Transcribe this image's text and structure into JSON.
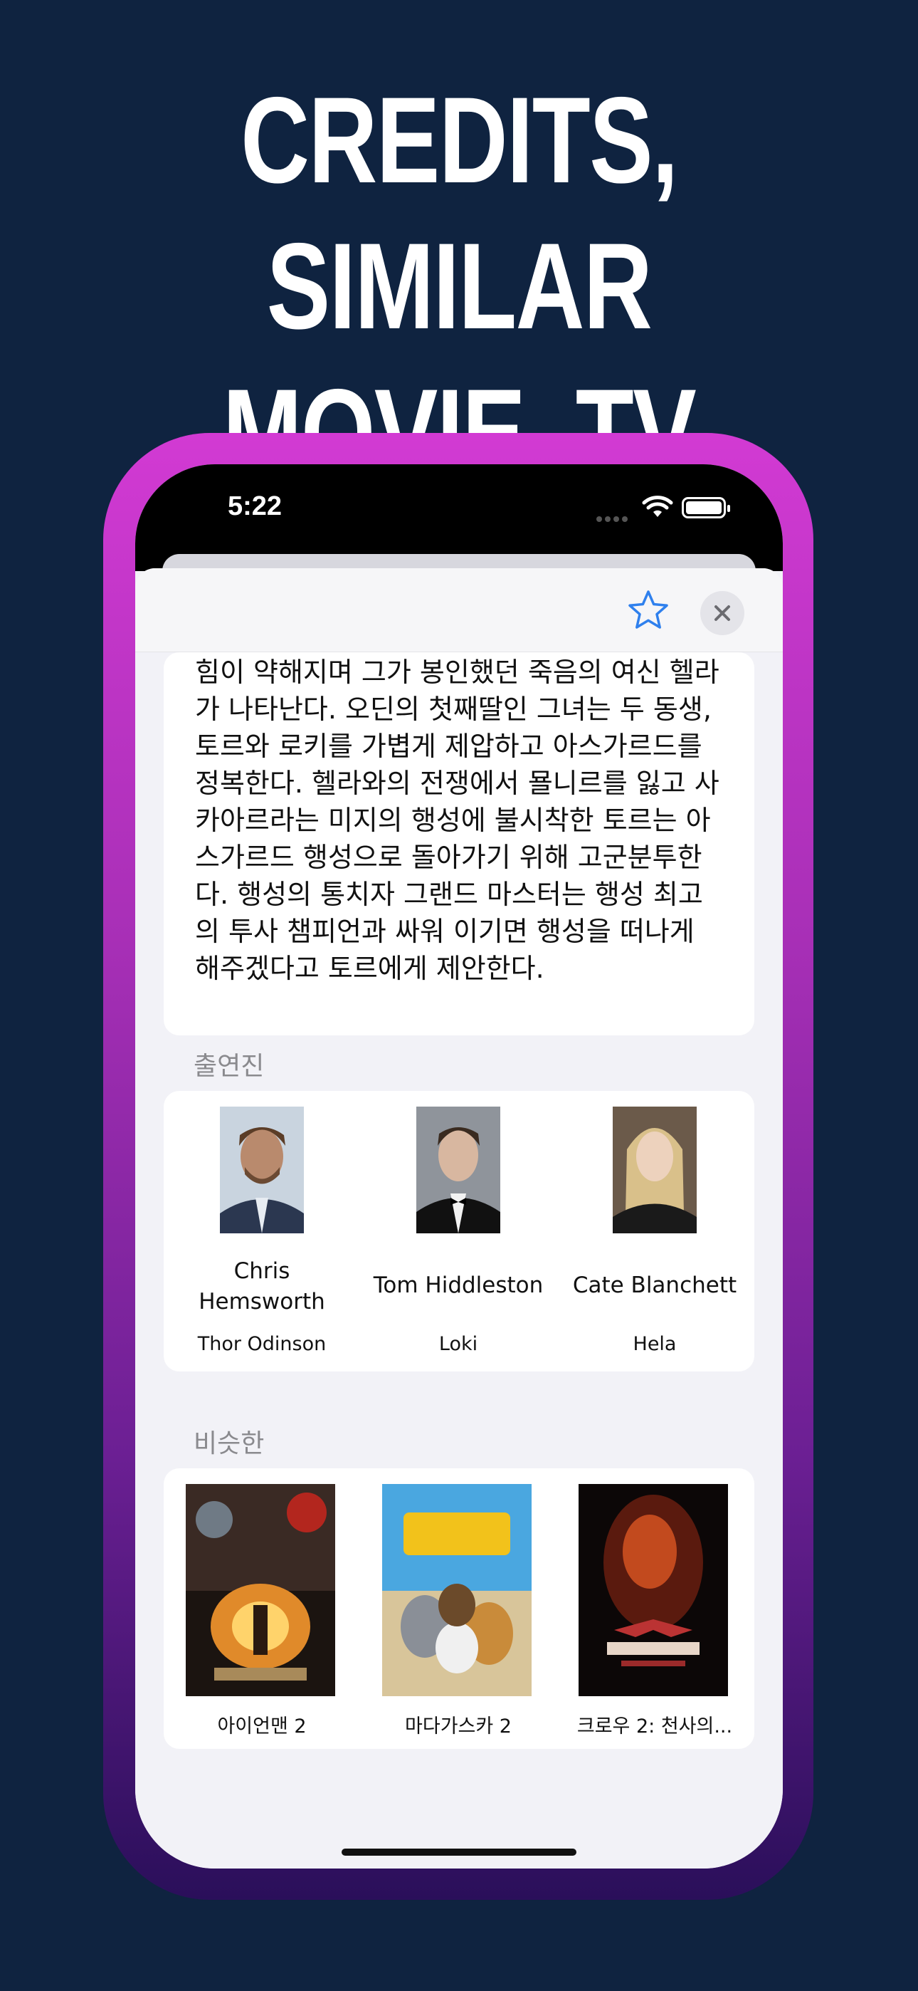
{
  "headline": {
    "line1": "CREDITS, SIMILAR",
    "line2": "MOVIE, TV SHOW"
  },
  "status_bar": {
    "time": "5:22"
  },
  "navbar": {
    "favorite_icon": "star-outline-icon",
    "close_icon": "close-icon"
  },
  "overview": {
    "text": "힘이 약해지며 그가 봉인했던 죽음의 여신 헬라가 나타난다. 오딘의 첫째딸인 그녀는 두 동생, 토르와 로키를 가볍게 제압하고 아스가르드를 정복한다. 헬라와의 전쟁에서 묠니르를 잃고 사카아르라는 미지의 행성에 불시착한 토르는 아스가르드 행성으로 돌아가기 위해 고군분투한다. 행성의 통치자 그랜드 마스터는 행성 최고의 투사 챔피언과 싸워 이기면 행성을 떠나게 해주겠다고 토르에게 제안한다."
  },
  "cast_section": {
    "title": "출연진",
    "items": [
      {
        "name": "Chris Hemsworth",
        "character": "Thor Odinson"
      },
      {
        "name": "Tom Hiddleston",
        "character": "Loki"
      },
      {
        "name": "Cate Blanchett",
        "character": "Hela"
      }
    ]
  },
  "similar_section": {
    "title": "비슷한",
    "items": [
      {
        "title": "아이언맨 2"
      },
      {
        "title": "마다가스카 2"
      },
      {
        "title": "크로우 2: 천사의..."
      }
    ]
  },
  "colors": {
    "background": "#0f2340",
    "phone_gradient_top": "#d23ad3",
    "phone_gradient_bottom": "#2a0f5a",
    "accent": "#2f80ed"
  }
}
